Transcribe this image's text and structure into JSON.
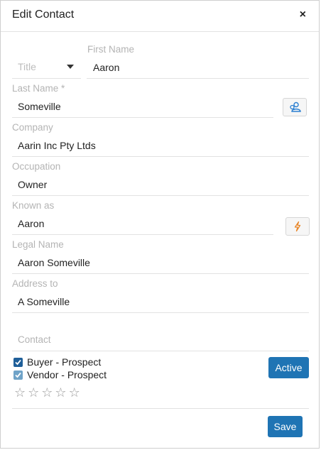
{
  "dialog": {
    "title": "Edit Contact",
    "close_icon": "×"
  },
  "form": {
    "title_field": {
      "placeholder": "Title"
    },
    "first_name": {
      "label": "First Name",
      "value": "Aaron"
    },
    "last_name": {
      "label": "Last Name *",
      "value": "Someville"
    },
    "company": {
      "label": "Company",
      "value": "Aarin Inc Pty Ltds"
    },
    "occupation": {
      "label": "Occupation",
      "value": "Owner"
    },
    "known_as": {
      "label": "Known as",
      "value": "Aaron"
    },
    "legal_name": {
      "label": "Legal Name",
      "value": "Aaron Someville"
    },
    "address_to": {
      "label": "Address to",
      "value": "A Someville"
    },
    "contact": {
      "placeholder": "Contact"
    }
  },
  "roles": [
    {
      "label": "Buyer - Prospect",
      "checked": true,
      "color": "#1f5f99"
    },
    {
      "label": "Vendor - Prospect",
      "checked": true,
      "color": "#6fa3c8"
    }
  ],
  "status_button": {
    "label": "Active"
  },
  "rating": {
    "value": 0,
    "max": 5,
    "star_char": "☆"
  },
  "footer": {
    "save_label": "Save"
  },
  "colors": {
    "primary": "#1f74b4",
    "icon_blue": "#2a7fd1",
    "icon_orange": "#e8872a"
  },
  "icons": {
    "last_name_action": "people-search-icon",
    "known_as_action": "lightning-icon"
  }
}
